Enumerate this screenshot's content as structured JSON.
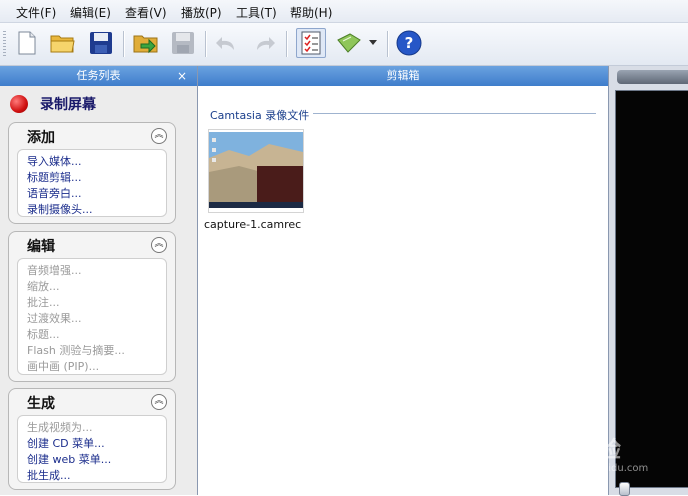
{
  "menu": [
    "文件(F)",
    "编辑(E)",
    "查看(V)",
    "播放(P)",
    "工具(T)",
    "帮助(H)"
  ],
  "toolbar": {
    "icons": [
      "new-file-icon",
      "open-folder-icon",
      "save-icon",
      "import-icon",
      "save-disabled-icon",
      "undo-icon",
      "redo-icon",
      "task-list-icon",
      "produce-icon",
      "dropdown-arrow-icon",
      "help-icon"
    ],
    "active": "task-list-icon"
  },
  "task_panel": {
    "title": "任务列表",
    "close": "×",
    "record": "录制屏幕",
    "groups": [
      {
        "title": "添加",
        "items": [
          {
            "label": "导入媒体...",
            "enabled": true
          },
          {
            "label": "标题剪辑...",
            "enabled": true
          },
          {
            "label": "语音旁白...",
            "enabled": true
          },
          {
            "label": "录制摄像头...",
            "enabled": true
          }
        ]
      },
      {
        "title": "编辑",
        "items": [
          {
            "label": "音频增强...",
            "enabled": false
          },
          {
            "label": "缩放...",
            "enabled": false
          },
          {
            "label": "批注...",
            "enabled": false
          },
          {
            "label": "过渡效果...",
            "enabled": false
          },
          {
            "label": "标题...",
            "enabled": false
          },
          {
            "label": "Flash 测验与摘要...",
            "enabled": false
          },
          {
            "label": "画中画 (PIP)...",
            "enabled": false
          }
        ]
      },
      {
        "title": "生成",
        "items": [
          {
            "label": "生成视频为...",
            "enabled": false
          },
          {
            "label": "创建 CD 菜单...",
            "enabled": true
          },
          {
            "label": "创建 web 菜单...",
            "enabled": true
          },
          {
            "label": "批生成...",
            "enabled": true
          }
        ]
      }
    ]
  },
  "clip_bin": {
    "title": "剪辑箱",
    "section": "Camtasia 录像文件",
    "files": [
      {
        "name": "capture-1.camrec"
      }
    ]
  },
  "watermark": {
    "text": "Bai 经验",
    "url": "jingyan.baidu.com"
  },
  "colors": {
    "header_blue": "#4f8ad4",
    "link_blue": "#1b2d8c",
    "disabled_gray": "#9a9a9a",
    "record_red": "#d01010"
  }
}
